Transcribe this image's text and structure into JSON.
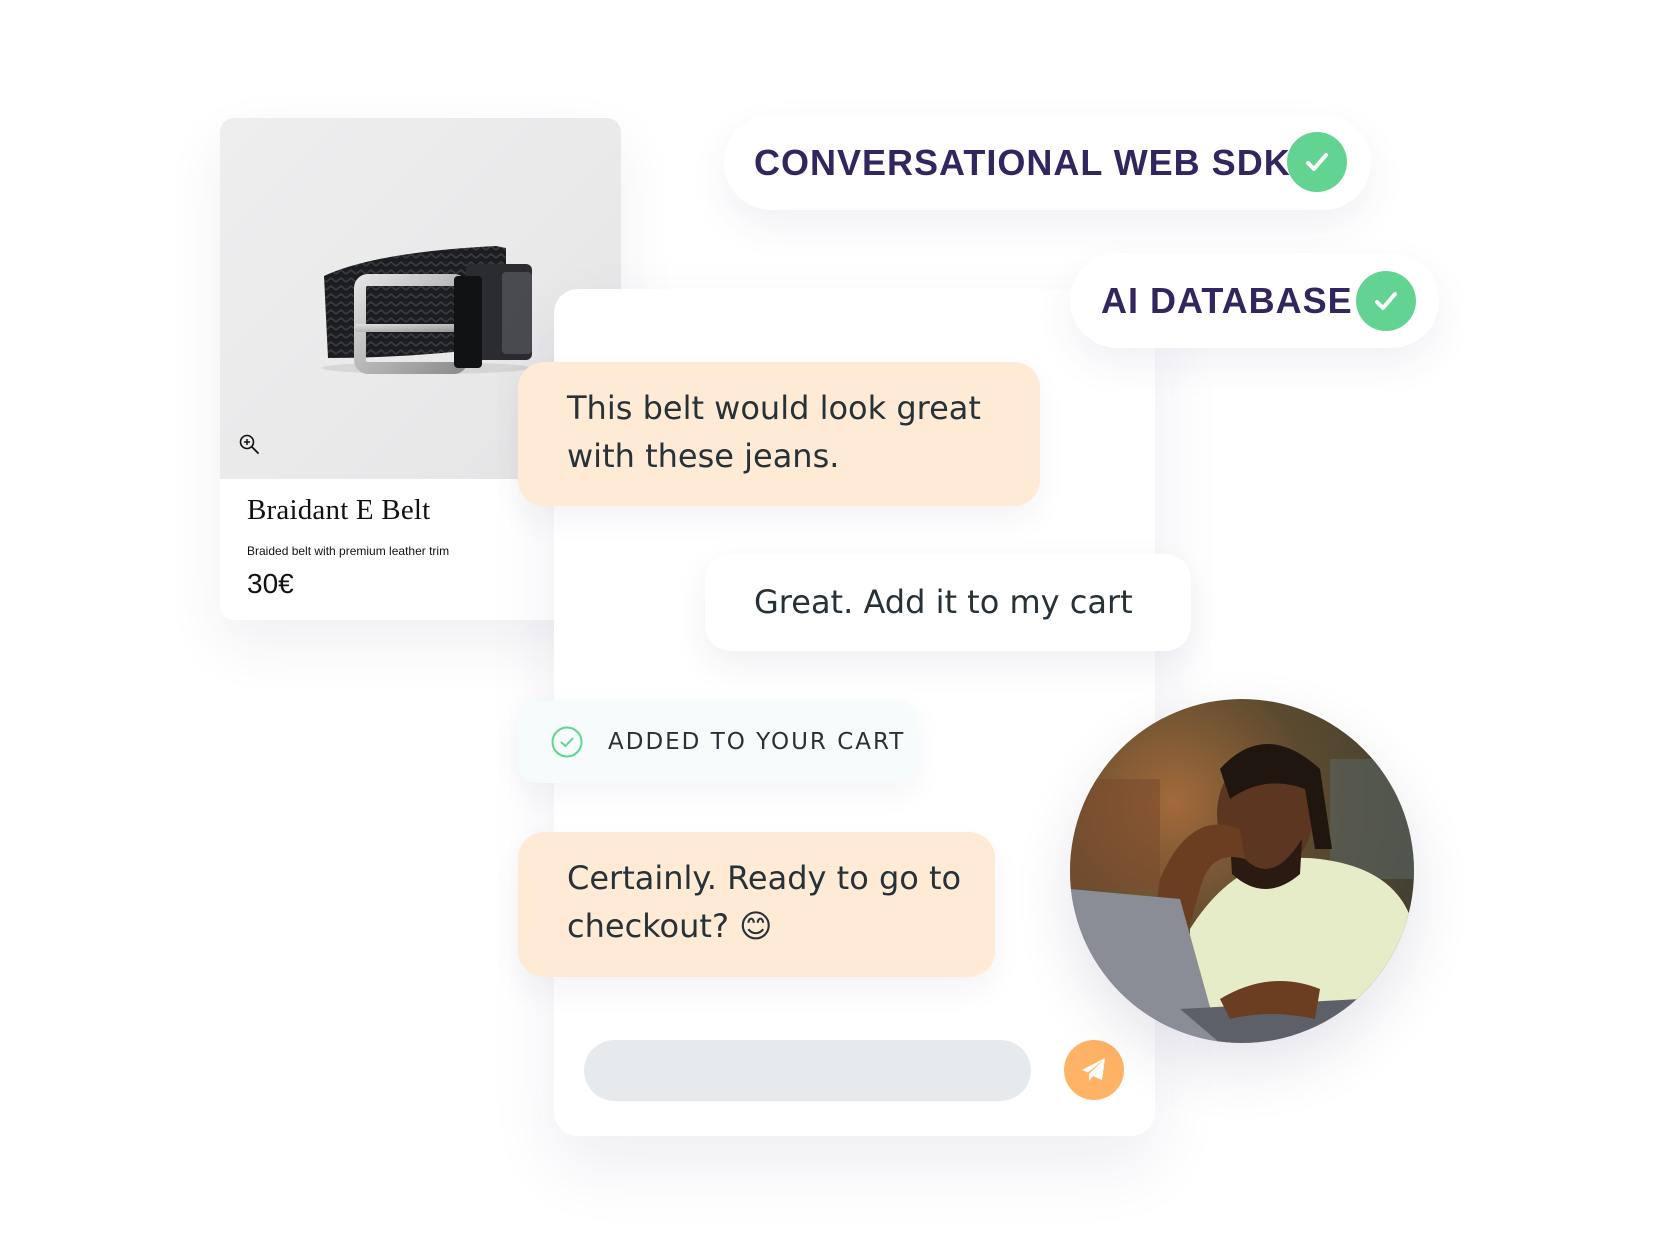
{
  "product": {
    "title": "Braidant E Belt",
    "description": "Braided belt with premium leather trim",
    "price": "30€",
    "zoom_icon": "zoom-in-icon"
  },
  "features": [
    {
      "label": "CONVERSATIONAL WEB SDK",
      "icon": "check-icon",
      "status": "checked"
    },
    {
      "label": "AI DATABASE",
      "icon": "check-icon",
      "status": "checked"
    }
  ],
  "chat": {
    "messages": [
      {
        "sender": "bot",
        "text": "This belt would look great with these jeans."
      },
      {
        "sender": "user",
        "text": "Great. Add it to my cart"
      },
      {
        "sender": "bot",
        "text": "Certainly. Ready to go to checkout? 😊"
      }
    ],
    "notice": {
      "label": "ADDED TO YOUR CART",
      "icon": "check-circle-icon"
    },
    "input": {
      "value": "",
      "placeholder": ""
    },
    "send_icon": "paper-plane-icon"
  },
  "colors": {
    "accent": "#ffb366",
    "success": "#62d391",
    "bot_bubble": "#feead5",
    "pill_text": "#33265f",
    "input_bg": "#e6eaed"
  }
}
